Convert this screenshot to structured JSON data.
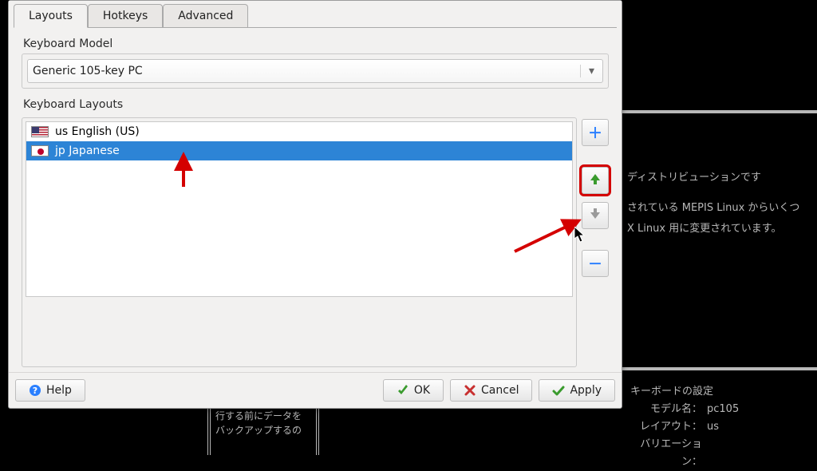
{
  "tabs": {
    "layouts": "Layouts",
    "hotkeys": "Hotkeys",
    "advanced": "Advanced",
    "active": "layouts"
  },
  "model": {
    "label": "Keyboard Model",
    "value": "Generic 105-key PC"
  },
  "layouts": {
    "label": "Keyboard Layouts",
    "items": [
      {
        "flag": "us",
        "text": "us English (US)"
      },
      {
        "flag": "jp",
        "text": "jp Japanese"
      }
    ],
    "selected_index": 1
  },
  "buttons": {
    "help": "Help",
    "ok": "OK",
    "cancel": "Cancel",
    "apply": "Apply"
  },
  "side": {
    "add": "plus-icon",
    "up": "arrow-up-icon",
    "down": "arrow-down-icon",
    "remove": "minus-icon"
  },
  "background": {
    "panel_line1": "ディストリビューションです",
    "panel_line2": "されている MEPIS Linux からいくつ",
    "panel_line3": "X Linux 用に変更されています。",
    "info_title": "キーボードの設定",
    "info_model_label": "モデル名：",
    "info_model_value": "pc105",
    "info_layout_label": "レイアウト：",
    "info_layout_value": "us",
    "info_variation_label": "バリエーション：",
    "bottom_box": "行する前にデータを\nバックアップするの"
  },
  "annotation": {
    "highlighted_button": "up"
  }
}
